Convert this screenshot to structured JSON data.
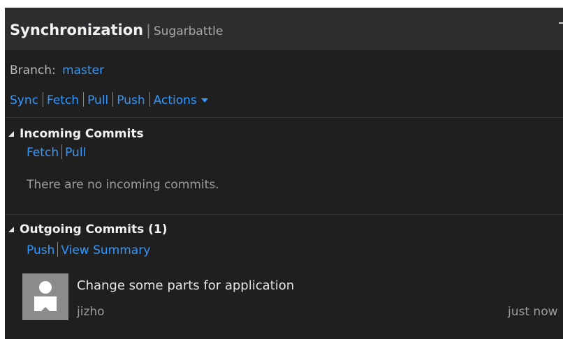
{
  "header": {
    "title": "Synchronization",
    "separator": "|",
    "repo": "Sugarbattle"
  },
  "branch": {
    "label": "Branch:",
    "name": "master"
  },
  "actions": {
    "sync": "Sync",
    "fetch": "Fetch",
    "pull": "Pull",
    "push": "Push",
    "more": "Actions"
  },
  "incoming": {
    "title": "Incoming Commits",
    "fetch": "Fetch",
    "pull": "Pull",
    "empty_message": "There are no incoming commits."
  },
  "outgoing": {
    "title": "Outgoing Commits (1)",
    "push": "Push",
    "view_summary": "View Summary",
    "commits": [
      {
        "message": "Change some parts for application",
        "author": "jizho",
        "time": "just now"
      }
    ]
  },
  "colors": {
    "link": "#3399ff",
    "background": "#1f1f20",
    "header_background": "#2d2d30"
  },
  "icons": {
    "section_toggle": "expanded-triangle-icon",
    "actions_dropdown": "caret-down-icon",
    "avatar": "user-avatar-icon"
  }
}
